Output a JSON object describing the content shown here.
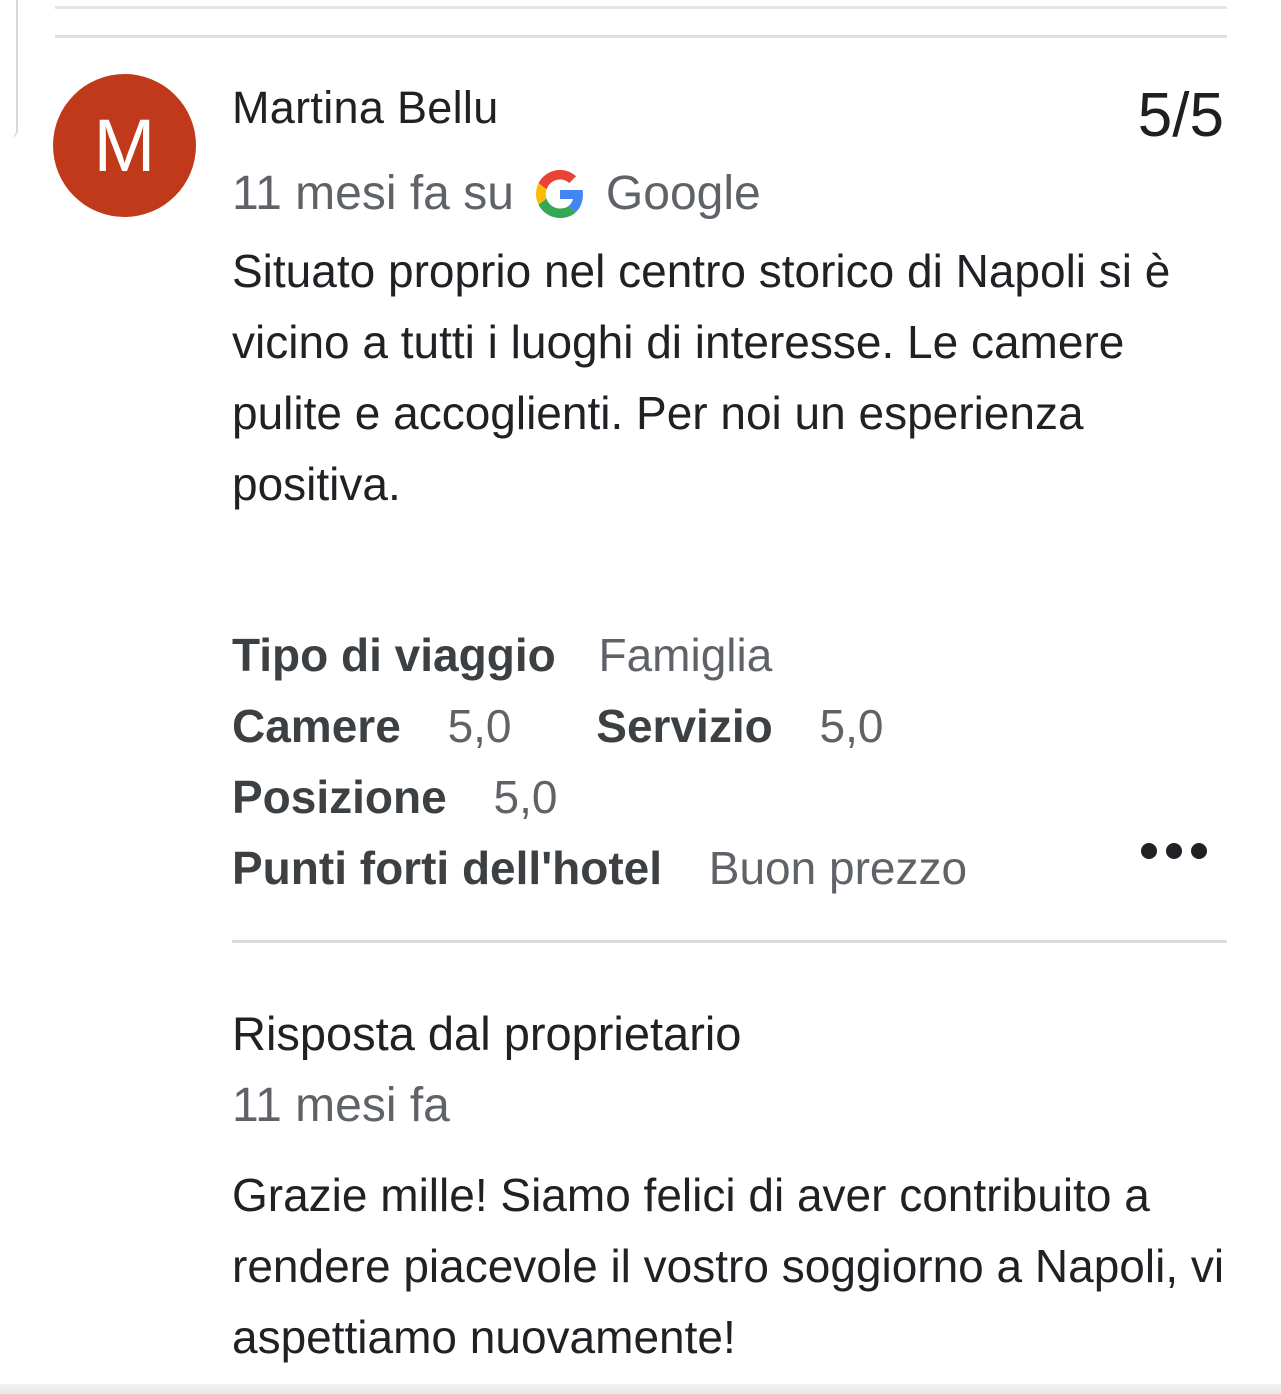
{
  "review": {
    "avatar_letter": "M",
    "avatar_color": "#c0391b",
    "reviewer_name": "Martina Bellu",
    "score": "5/5",
    "time": "11 mesi fa su",
    "source": "Google",
    "source_icon": "google-g-icon",
    "text": "Situato proprio nel centro storico di Napoli si è vicino a tutti i luoghi di interesse. Le camere pulite e accoglienti. Per noi un esperienza positiva."
  },
  "details": {
    "trip_type_label": "Tipo di viaggio",
    "trip_type_value": "Famiglia",
    "rooms_label": "Camere",
    "rooms_value": "5,0",
    "service_label": "Servizio",
    "service_value": "5,0",
    "location_label": "Posizione",
    "location_value": "5,0",
    "highlights_label": "Punti forti dell'hotel",
    "highlights_value": "Buon prezzo"
  },
  "owner_reply": {
    "title": "Risposta dal proprietario",
    "time": "11 mesi fa",
    "text": "Grazie mille! Siamo felici di aver contribuito a rendere piacevole il vostro soggiorno a Napoli, vi aspettiamo nuovamente!"
  },
  "icons": {
    "more": "more-horizontal-icon"
  }
}
